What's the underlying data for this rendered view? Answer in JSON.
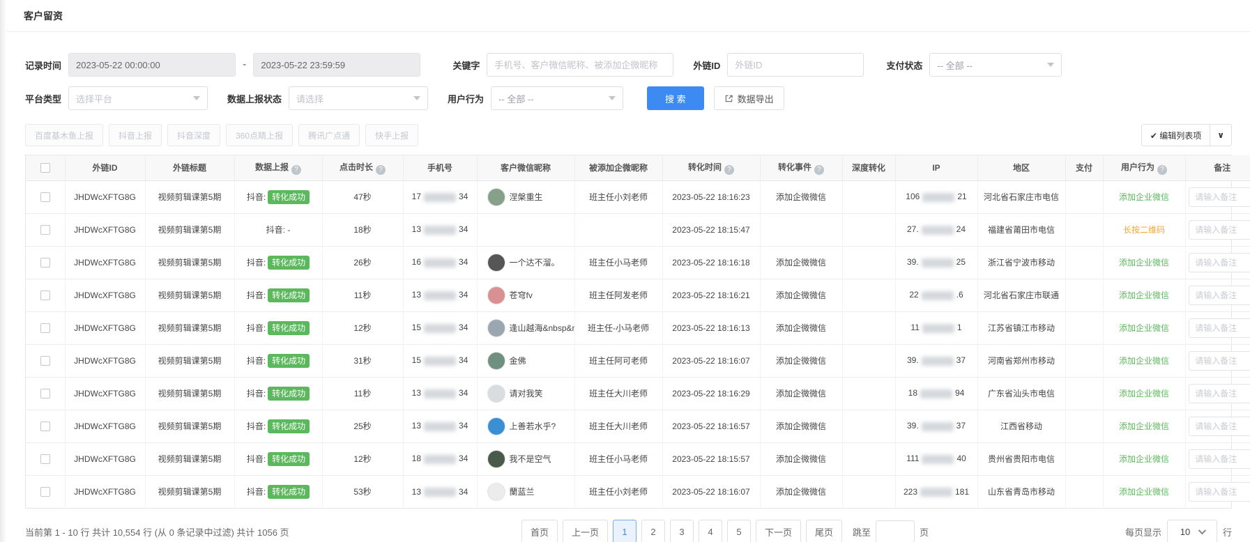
{
  "page": {
    "title": "客户留资"
  },
  "colors": {
    "accent_blue": "#3d8bf2",
    "success_green": "#5cb85c",
    "warn_orange": "#f5a633"
  },
  "filters": {
    "record_time": {
      "label": "记录时间",
      "start": "2023-05-22 00:00:00",
      "separator": "-",
      "end": "2023-05-22 23:59:59"
    },
    "keyword": {
      "label": "关键字",
      "placeholder": "手机号、客户微信昵称、被添加企微昵称"
    },
    "external_id": {
      "label": "外链ID",
      "placeholder": "外链ID"
    },
    "pay_status": {
      "label": "支付状态",
      "value": "-- 全部 --"
    },
    "platform_type": {
      "label": "平台类型",
      "placeholder": "选择平台"
    },
    "report_status": {
      "label": "数据上报状态",
      "placeholder": "请选择"
    },
    "user_behavior": {
      "label": "用户行为",
      "value": "-- 全部 --"
    },
    "search_label": "搜 索",
    "export_label": "数据导出"
  },
  "report_buttons": [
    {
      "label": "百度基木鱼上报"
    },
    {
      "label": "抖音上报"
    },
    {
      "label": "抖音深度"
    },
    {
      "label": "360点睛上报"
    },
    {
      "label": "腾讯广点通"
    },
    {
      "label": "快手上报"
    }
  ],
  "edit_columns": {
    "check": "✔",
    "label": "编辑列表项",
    "caret": "∨"
  },
  "table": {
    "note_placeholder": "请输入备注",
    "headers": [
      {
        "label": "",
        "type": "checkbox"
      },
      {
        "label": "外链ID"
      },
      {
        "label": "外链标题"
      },
      {
        "label": "数据上报",
        "help": true
      },
      {
        "label": "点击时长",
        "help": true
      },
      {
        "label": "手机号"
      },
      {
        "label": "客户微信昵称"
      },
      {
        "label": "被添加企微昵称"
      },
      {
        "label": "转化时间",
        "help": true
      },
      {
        "label": "转化事件",
        "help": true
      },
      {
        "label": "深度转化"
      },
      {
        "label": "IP"
      },
      {
        "label": "地区"
      },
      {
        "label": "支付"
      },
      {
        "label": "用户行为",
        "help": true
      },
      {
        "label": "备注"
      }
    ],
    "rows": [
      {
        "link_id": "JHDWcXFTG8G",
        "link_title": "视频剪辑课第5期",
        "report_prefix": "抖音:",
        "report_badge": "转化成功",
        "duration": "47秒",
        "phone_prefix": "17",
        "phone_suffix": "34",
        "nickname": "涅槃重生",
        "avatar_color": "#86a08a",
        "added_name": "班主任小刘老师",
        "conv_time": "2023-05-22 18:16:23",
        "conv_event": "添加企微微信",
        "deep_conv": "",
        "ip_prefix": "106",
        "ip_suffix": "21",
        "region": "河北省石家庄市电信",
        "pay": "",
        "behavior": "添加企业微信",
        "behavior_color": "green"
      },
      {
        "link_id": "JHDWcXFTG8G",
        "link_title": "视频剪辑课第5期",
        "report_prefix": "抖音: -",
        "report_badge": "",
        "duration": "18秒",
        "phone_prefix": "13",
        "phone_suffix": "34",
        "nickname": "",
        "avatar_color": "",
        "added_name": "",
        "conv_time": "2023-05-22 18:15:47",
        "conv_event": "",
        "deep_conv": "",
        "ip_prefix": "27.",
        "ip_suffix": "24",
        "region": "福建省莆田市电信",
        "pay": "",
        "behavior": "长按二维码",
        "behavior_color": "orange"
      },
      {
        "link_id": "JHDWcXFTG8G",
        "link_title": "视频剪辑课第5期",
        "report_prefix": "抖音:",
        "report_badge": "转化成功",
        "duration": "26秒",
        "phone_prefix": "16",
        "phone_suffix": "34",
        "nickname": "一个达不溜。",
        "avatar_color": "#565656",
        "added_name": "班主任小马老师",
        "conv_time": "2023-05-22 18:16:18",
        "conv_event": "添加企微微信",
        "deep_conv": "",
        "ip_prefix": "39.",
        "ip_suffix": "25",
        "region": "浙江省宁波市移动",
        "pay": "",
        "behavior": "添加企业微信",
        "behavior_color": "green"
      },
      {
        "link_id": "JHDWcXFTG8G",
        "link_title": "视频剪辑课第5期",
        "report_prefix": "抖音:",
        "report_badge": "转化成功",
        "duration": "11秒",
        "phone_prefix": "13",
        "phone_suffix": "34",
        "nickname": "苍穹fv",
        "avatar_color": "#d89090",
        "added_name": "班主任阿发老师",
        "conv_time": "2023-05-22 18:16:21",
        "conv_event": "添加企微微信",
        "deep_conv": "",
        "ip_prefix": "22",
        "ip_suffix": ".6",
        "region": "河北省石家庄市联通",
        "pay": "",
        "behavior": "添加企业微信",
        "behavior_color": "green"
      },
      {
        "link_id": "JHDWcXFTG8G",
        "link_title": "视频剪辑课第5期",
        "report_prefix": "抖音:",
        "report_badge": "转化成功",
        "duration": "12秒",
        "phone_prefix": "15",
        "phone_suffix": "34",
        "nickname": "逢山越海&nbsp&nbsp",
        "avatar_color": "#9aa7b0",
        "added_name": "班主任-小马老师",
        "conv_time": "2023-05-22 18:16:13",
        "conv_event": "添加企微微信",
        "deep_conv": "",
        "ip_prefix": "11",
        "ip_suffix": "1",
        "region": "江苏省镇江市移动",
        "pay": "",
        "behavior": "添加企业微信",
        "behavior_color": "green"
      },
      {
        "link_id": "JHDWcXFTG8G",
        "link_title": "视频剪辑课第5期",
        "report_prefix": "抖音:",
        "report_badge": "转化成功",
        "duration": "31秒",
        "phone_prefix": "15",
        "phone_suffix": "34",
        "nickname": "金佛",
        "avatar_color": "#6f8f7f",
        "added_name": "班主任阿可老师",
        "conv_time": "2023-05-22 18:16:07",
        "conv_event": "添加企微微信",
        "deep_conv": "",
        "ip_prefix": "39.",
        "ip_suffix": "37",
        "region": "河南省郑州市移动",
        "pay": "",
        "behavior": "添加企业微信",
        "behavior_color": "green"
      },
      {
        "link_id": "JHDWcXFTG8G",
        "link_title": "视频剪辑课第5期",
        "report_prefix": "抖音:",
        "report_badge": "转化成功",
        "duration": "11秒",
        "phone_prefix": "13",
        "phone_suffix": "34",
        "nickname": "请对我笑",
        "avatar_color": "#d8dde0",
        "added_name": "班主任大川老师",
        "conv_time": "2023-05-22 18:16:29",
        "conv_event": "添加企微微信",
        "deep_conv": "",
        "ip_prefix": "18",
        "ip_suffix": "94",
        "region": "广东省汕头市电信",
        "pay": "",
        "behavior": "添加企业微信",
        "behavior_color": "green"
      },
      {
        "link_id": "JHDWcXFTG8G",
        "link_title": "视频剪辑课第5期",
        "report_prefix": "抖音:",
        "report_badge": "转化成功",
        "duration": "25秒",
        "phone_prefix": "13",
        "phone_suffix": "34",
        "nickname": "上善若水乎?",
        "avatar_color": "#3b8fd4",
        "added_name": "班主任大川老师",
        "conv_time": "2023-05-22 18:16:57",
        "conv_event": "添加企微微信",
        "deep_conv": "",
        "ip_prefix": "39.",
        "ip_suffix": "37",
        "region": "江西省移动",
        "pay": "",
        "behavior": "添加企业微信",
        "behavior_color": "green"
      },
      {
        "link_id": "JHDWcXFTG8G",
        "link_title": "视频剪辑课第5期",
        "report_prefix": "抖音:",
        "report_badge": "转化成功",
        "duration": "12秒",
        "phone_prefix": "18",
        "phone_suffix": "34",
        "nickname": "我不是空气",
        "avatar_color": "#4a5a4a",
        "added_name": "班主任小马老师",
        "conv_time": "2023-05-22 18:15:57",
        "conv_event": "添加企微微信",
        "deep_conv": "",
        "ip_prefix": "111",
        "ip_suffix": "40",
        "region": "贵州省贵阳市电信",
        "pay": "",
        "behavior": "添加企业微信",
        "behavior_color": "green"
      },
      {
        "link_id": "JHDWcXFTG8G",
        "link_title": "视频剪辑课第5期",
        "report_prefix": "抖音:",
        "report_badge": "转化成功",
        "duration": "53秒",
        "phone_prefix": "13",
        "phone_suffix": "34",
        "nickname": "蘭蓝兰",
        "avatar_color": "#ececec",
        "added_name": "班主任小刘老师",
        "conv_time": "2023-05-22 18:16:07",
        "conv_event": "添加企微微信",
        "deep_conv": "",
        "ip_prefix": "223",
        "ip_suffix": "181",
        "region": "山东省青岛市移动",
        "pay": "",
        "behavior": "添加企业微信",
        "behavior_color": "green"
      }
    ]
  },
  "footer": {
    "summary": "当前第 1 - 10 行   共计 10,554 行 (从 0 条记录中过滤)   共计 1056 页",
    "pagination": {
      "first": "首页",
      "prev": "上一页",
      "pages": [
        "1",
        "2",
        "3",
        "4",
        "5"
      ],
      "active_page": "1",
      "next": "下一页",
      "last": "尾页",
      "jump_label": "跳至",
      "jump_suffix": "页"
    },
    "page_size": {
      "label": "每页显示",
      "value": "10",
      "suffix": "行"
    }
  }
}
